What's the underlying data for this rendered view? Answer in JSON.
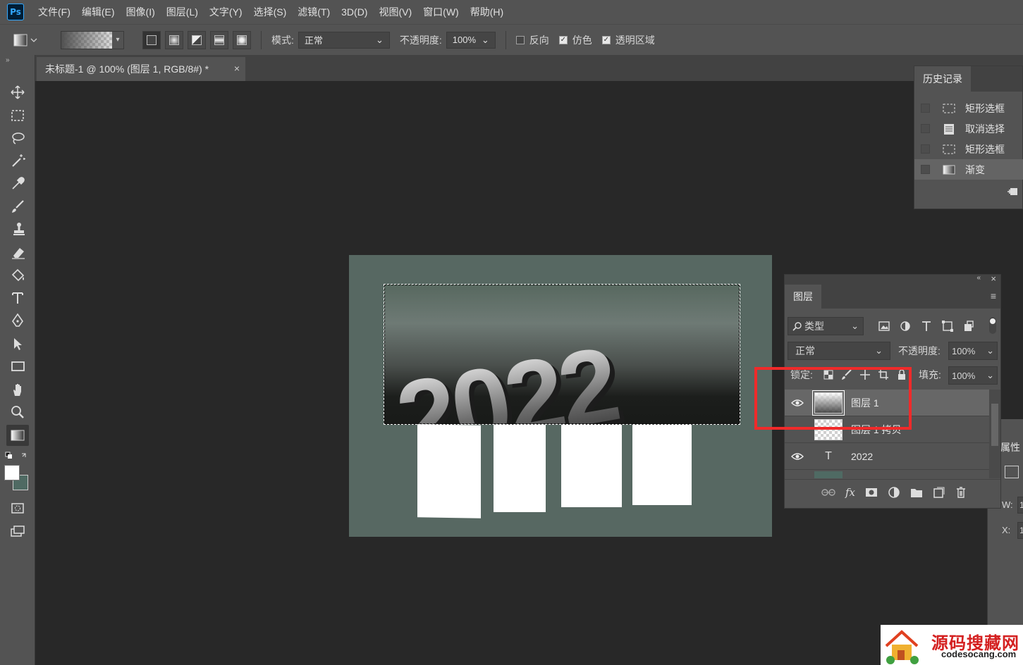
{
  "app": {
    "logo": "Ps"
  },
  "menu": [
    "文件(F)",
    "编辑(E)",
    "图像(I)",
    "图层(L)",
    "文字(Y)",
    "选择(S)",
    "滤镜(T)",
    "3D(D)",
    "视图(V)",
    "窗口(W)",
    "帮助(H)"
  ],
  "options": {
    "mode_label": "模式:",
    "mode_value": "正常",
    "opacity_label": "不透明度:",
    "opacity_value": "100%",
    "reverse_label": "反向",
    "reverse_checked": false,
    "dither_label": "仿色",
    "dither_checked": true,
    "transparency_label": "透明区域",
    "transparency_checked": true
  },
  "document": {
    "tab_title": "未标题-1 @ 100% (图层 1, RGB/8#) *",
    "close": "×"
  },
  "canvas": {
    "text": "2022",
    "bg_color": "#576862"
  },
  "history": {
    "tab": "历史记录",
    "items": [
      {
        "label": "矩形选框",
        "icon": "marquee-icon"
      },
      {
        "label": "取消选择",
        "icon": "document-icon"
      },
      {
        "label": "矩形选框",
        "icon": "marquee-icon"
      },
      {
        "label": "渐变",
        "icon": "gradient-icon",
        "selected": true
      }
    ]
  },
  "layers": {
    "tab": "图层",
    "filter_kind": "类型",
    "blend_mode": "正常",
    "opacity_label": "不透明度:",
    "opacity_value": "100%",
    "lock_label": "锁定:",
    "fill_label": "填充:",
    "fill_value": "100%",
    "rows": [
      {
        "name": "图层 1",
        "kind": "pixel",
        "visible": true,
        "selected": true
      },
      {
        "name": "图层 1 拷贝",
        "kind": "pixel",
        "visible": false,
        "selected": false
      },
      {
        "name": "2022",
        "kind": "text",
        "visible": true,
        "selected": false
      }
    ]
  },
  "properties": {
    "tab": "属性",
    "w_label": "W:",
    "x_label": "X:",
    "w_value": "1",
    "x_value": "1"
  },
  "watermark": {
    "title": "源码搜藏网",
    "url": "codesocang.com"
  },
  "colors": {
    "annotation": "#f02a2a",
    "foreground": "#ffffff",
    "background": "#4f6a63"
  }
}
